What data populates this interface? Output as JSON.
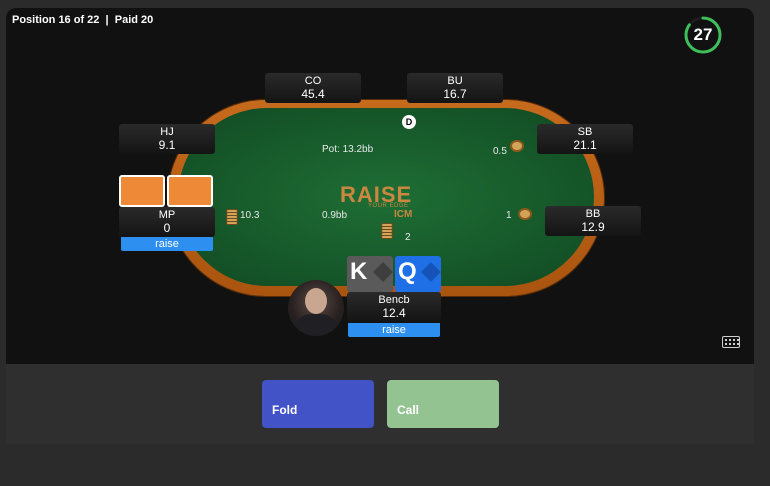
{
  "header": {
    "position_text": "Position 16 of 22",
    "separator": "|",
    "paid_text": "Paid 20"
  },
  "timer": {
    "seconds": "27",
    "remaining_fraction": 0.85,
    "color": "#3fbf5a"
  },
  "table": {
    "pot_label": "Pot: 13.2bb",
    "center_bet": "0.9bb",
    "dealer_button": "D",
    "colors": {
      "felt": "#16582a",
      "rim": "#b85f16"
    }
  },
  "seats": {
    "co": {
      "name": "CO",
      "stack": "45.4"
    },
    "bu": {
      "name": "BU",
      "stack": "16.7"
    },
    "hj": {
      "name": "HJ",
      "stack": "9.1"
    },
    "sb": {
      "name": "SB",
      "stack": "21.1",
      "bet": "0.5"
    },
    "mp": {
      "name": "MP",
      "stack": "0",
      "bet": "10.3",
      "action": "raise"
    },
    "bb": {
      "name": "BB",
      "stack": "12.9",
      "bet": "1"
    },
    "hero": {
      "name": "Bencb",
      "stack": "12.4",
      "bet": "2",
      "action": "raise",
      "cards": [
        {
          "rank": "K",
          "suit": "spade",
          "color": "#5a5a5a"
        },
        {
          "rank": "Q",
          "suit": "diamond",
          "color": "#1f6fe6"
        }
      ]
    }
  },
  "logo": {
    "main": "RAISE",
    "tagline": "YOUR EDGE",
    "sub": "ICM"
  },
  "actions": {
    "fold": "Fold",
    "call": "Call",
    "fold_color": "#4253c7",
    "call_color": "#93c390"
  },
  "icons": {
    "keyboard": "keyboard-icon"
  }
}
